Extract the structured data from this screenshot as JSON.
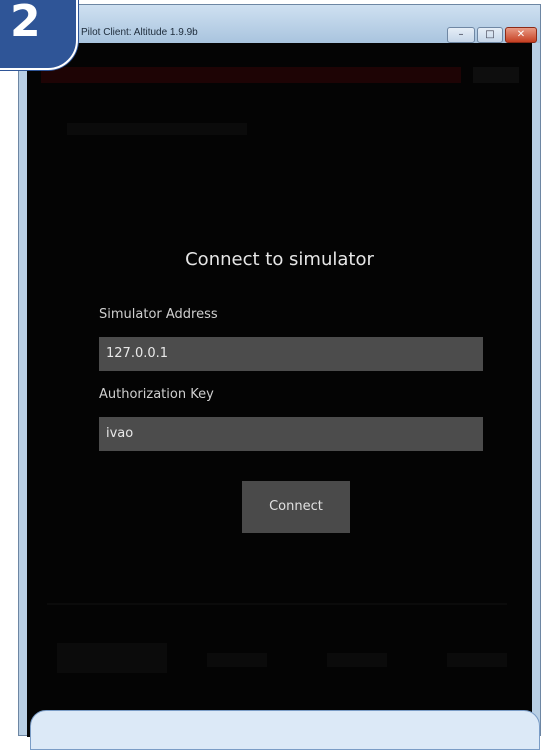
{
  "step_badge": {
    "number": "2"
  },
  "window": {
    "title": "Pilot Client: Altitude 1.9.9b",
    "controls": {
      "minimize": "–",
      "maximize": "□",
      "close": "✕"
    }
  },
  "dialog": {
    "title": "Connect to simulator",
    "address": {
      "label": "Simulator Address",
      "value": "127.0.0.1"
    },
    "authkey": {
      "label": "Authorization Key",
      "value": "ivao"
    },
    "connect_label": "Connect"
  },
  "colors": {
    "badge": "#2f5597",
    "client_background": "#040404",
    "field_background": "#4c4c4c",
    "button_background": "#4a4a4a"
  }
}
